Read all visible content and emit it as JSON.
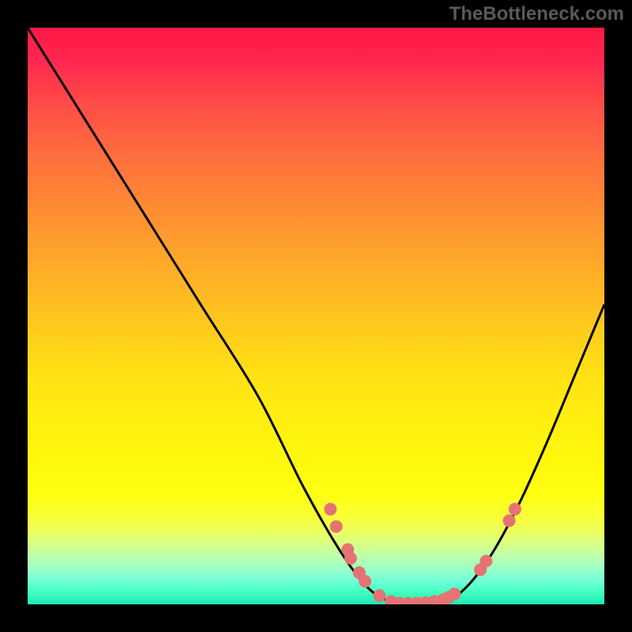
{
  "attribution": "TheBottleneck.com",
  "chart_data": {
    "type": "line",
    "title": "",
    "xlabel": "",
    "ylabel": "",
    "xlim": [
      0,
      100
    ],
    "ylim": [
      0,
      100
    ],
    "curve": [
      {
        "x": 0,
        "y": 100
      },
      {
        "x": 10,
        "y": 84
      },
      {
        "x": 20,
        "y": 68
      },
      {
        "x": 30,
        "y": 52
      },
      {
        "x": 40,
        "y": 36
      },
      {
        "x": 48,
        "y": 20
      },
      {
        "x": 55,
        "y": 8
      },
      {
        "x": 60,
        "y": 2
      },
      {
        "x": 65,
        "y": 0
      },
      {
        "x": 70,
        "y": 0
      },
      {
        "x": 75,
        "y": 2
      },
      {
        "x": 80,
        "y": 8
      },
      {
        "x": 85,
        "y": 17
      },
      {
        "x": 90,
        "y": 28
      },
      {
        "x": 95,
        "y": 40
      },
      {
        "x": 100,
        "y": 52
      }
    ],
    "markers": [
      {
        "x": 52.5,
        "y": 16.5
      },
      {
        "x": 53.5,
        "y": 13.5
      },
      {
        "x": 55.5,
        "y": 9.5
      },
      {
        "x": 56.0,
        "y": 8.0
      },
      {
        "x": 57.5,
        "y": 5.5
      },
      {
        "x": 58.5,
        "y": 4.0
      },
      {
        "x": 61.0,
        "y": 1.5
      },
      {
        "x": 63.0,
        "y": 0.5
      },
      {
        "x": 64.5,
        "y": 0.2
      },
      {
        "x": 66.0,
        "y": 0.2
      },
      {
        "x": 67.5,
        "y": 0.2
      },
      {
        "x": 69.0,
        "y": 0.3
      },
      {
        "x": 70.5,
        "y": 0.5
      },
      {
        "x": 72.0,
        "y": 0.8
      },
      {
        "x": 73.0,
        "y": 1.2
      },
      {
        "x": 74.0,
        "y": 1.8
      },
      {
        "x": 78.5,
        "y": 6.0
      },
      {
        "x": 79.5,
        "y": 7.5
      },
      {
        "x": 83.5,
        "y": 14.5
      },
      {
        "x": 84.5,
        "y": 16.5
      }
    ],
    "marker_color": "#e57373",
    "curve_color": "#000000"
  }
}
